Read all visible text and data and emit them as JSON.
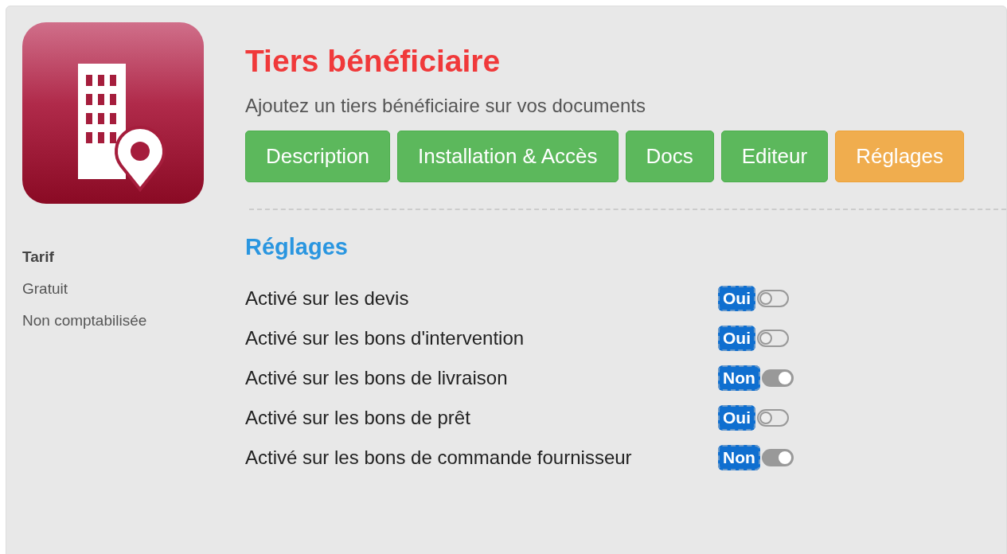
{
  "app": {
    "title": "Tiers bénéficiaire",
    "description": "Ajoutez un tiers bénéficiaire sur vos documents"
  },
  "tabs": [
    {
      "label": "Description",
      "selected": false
    },
    {
      "label": "Installation & Accès",
      "selected": false
    },
    {
      "label": "Docs",
      "selected": false
    },
    {
      "label": "Editeur",
      "selected": false
    },
    {
      "label": "Réglages",
      "selected": true
    }
  ],
  "pricing": {
    "heading": "Tarif",
    "lines": [
      "Gratuit",
      "Non comptabilisée"
    ]
  },
  "settings": {
    "heading": "Réglages",
    "rows": [
      {
        "label": "Activé sur les devis",
        "value": "Oui",
        "on": false
      },
      {
        "label": "Activé sur les bons d'intervention",
        "value": "Oui",
        "on": false
      },
      {
        "label": "Activé sur les bons de livraison",
        "value": "Non",
        "on": true
      },
      {
        "label": "Activé sur les bons de prêt",
        "value": "Oui",
        "on": false
      },
      {
        "label": "Activé sur les bons de commande fournisseur",
        "value": "Non",
        "on": true
      }
    ]
  }
}
